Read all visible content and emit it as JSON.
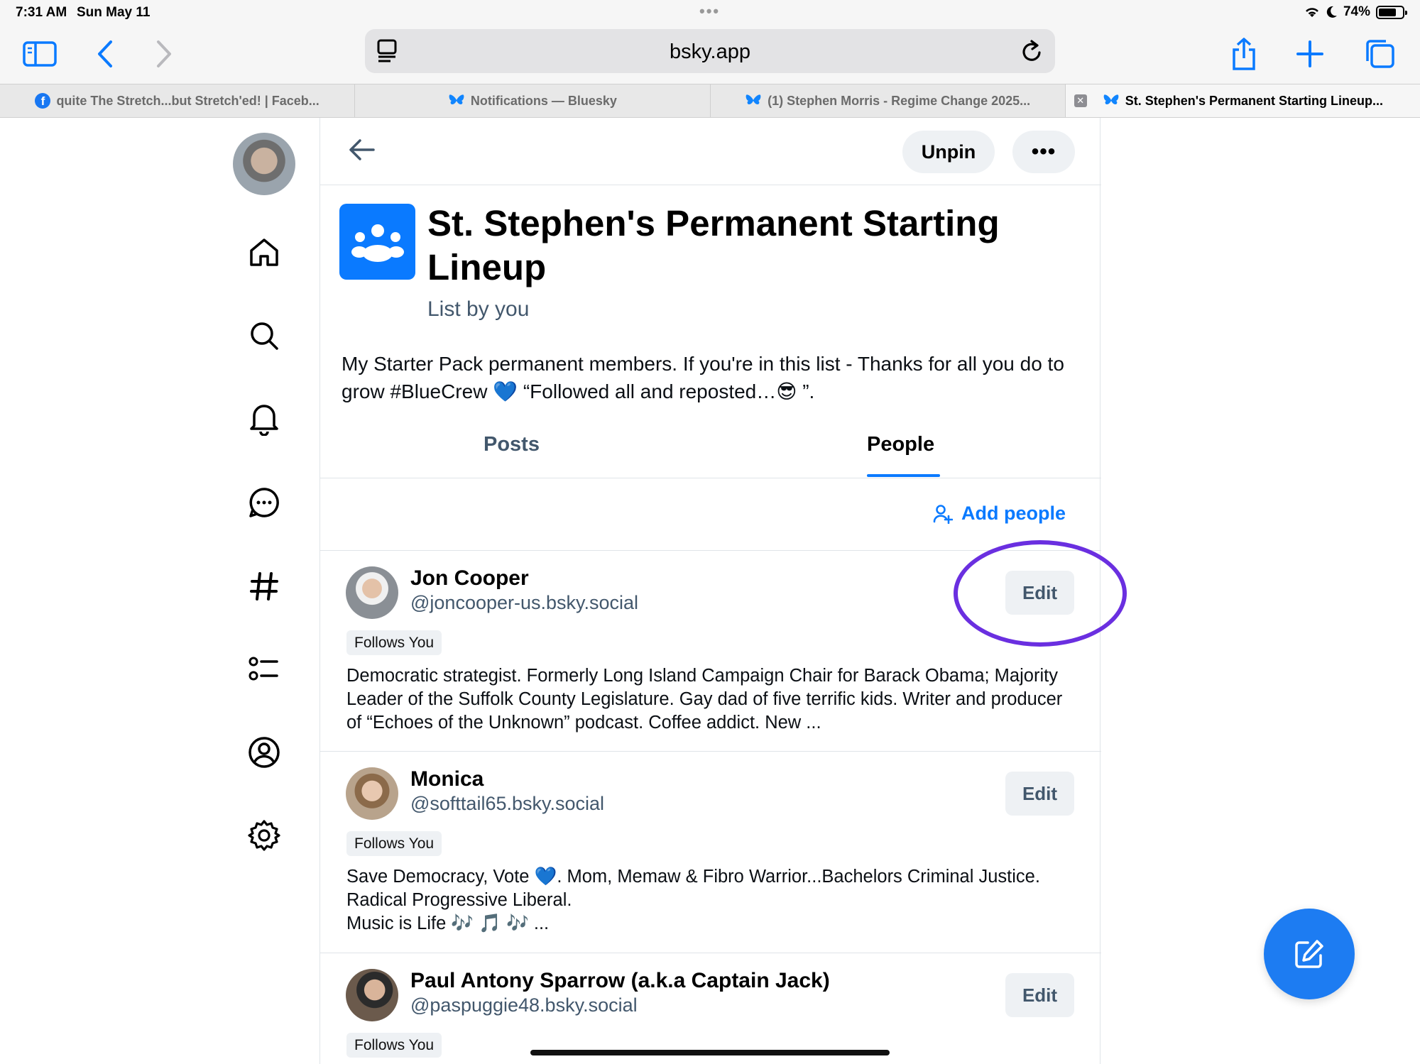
{
  "status_bar": {
    "time": "7:31 AM",
    "date": "Sun May 11",
    "battery": "74%",
    "battery_level": 0.74
  },
  "browser": {
    "domain": "bsky.app",
    "tabs": [
      {
        "label": "quite The Stretch...but Stretch'ed! | Faceb...",
        "icon": "facebook-icon"
      },
      {
        "label": "Notifications — Bluesky",
        "icon": "bluesky-butterfly-icon"
      },
      {
        "label": "(1) Stephen Morris - Regime Change 2025...",
        "icon": "bluesky-butterfly-icon"
      },
      {
        "label": "St. Stephen's Permanent Starting Lineup...",
        "icon": "bluesky-butterfly-icon",
        "active": true
      }
    ]
  },
  "header": {
    "unpin_label": "Unpin",
    "more_label": "•••"
  },
  "list": {
    "title": "St. Stephen's Permanent Starting Lineup",
    "byline": "List by you",
    "description": "My Starter Pack permanent members.  If you're in this list - Thanks for all you do to grow #BlueCrew 💙 “Followed all and reposted…😎 ”."
  },
  "tabs": {
    "posts": "Posts",
    "people": "People"
  },
  "add_people_label": "Add people",
  "people": [
    {
      "name": "Jon Cooper",
      "handle": "@joncooper-us.bsky.social",
      "badge": "Follows You",
      "edit_label": "Edit",
      "bio": "Democratic strategist. Formerly Long Island Campaign Chair for Barack Obama; Majority Leader of the Suffolk County Legislature. Gay dad of five terrific kids. Writer and producer of “Echoes of the Unknown” podcast. Coffee addict. New ..."
    },
    {
      "name": "Monica",
      "handle": "@softtail65.bsky.social",
      "badge": "Follows You",
      "edit_label": "Edit",
      "bio": "Save Democracy, Vote 💙. Mom, Memaw & Fibro Warrior...Bachelors Criminal Justice. Radical Progressive Liberal.\nMusic is Life 🎶 🎵 🎶 ..."
    },
    {
      "name": "Paul Antony Sparrow (a.k.a Captain Jack)",
      "handle": "@paspuggie48.bsky.social",
      "badge": "Follows You",
      "edit_label": "Edit",
      "bio": ""
    }
  ],
  "colors": {
    "accent": "#0a7aff",
    "muted": "#42576c",
    "highlight": "#6a2fe0"
  }
}
